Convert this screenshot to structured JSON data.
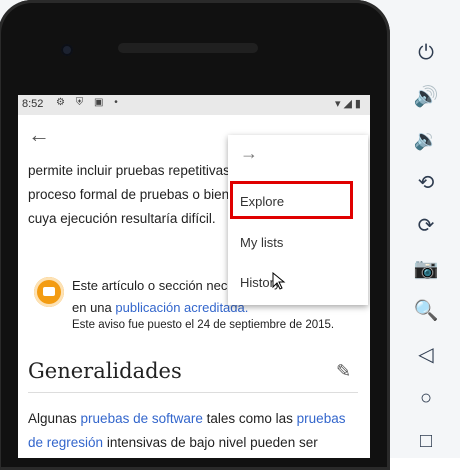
{
  "statusbar": {
    "time": "8:52"
  },
  "toolbar": {
    "back_label": "←"
  },
  "article": {
    "p1": "permite incluir pruebas repetitivas dentro de un proceso formal de pruebas o bien adicionar pruebas cuya ejecución resultaría difícil.",
    "notice_pre": "Este artículo o sección necesita que aparezcan en una ",
    "notice_link": "publicación acreditada.",
    "notice_small": "Este aviso fue puesto el 24 de septiembre de 2015.",
    "heading": "Generalidades",
    "p2_pre": "Algunas ",
    "p2_link1": "pruebas de software",
    "p2_mid": " tales como las ",
    "p2_link2": "pruebas de regresión",
    "p2_post": " intensivas de bajo nivel pueden ser"
  },
  "menu": {
    "forward_label": "→",
    "items": [
      "Explore",
      "My lists",
      "History"
    ]
  },
  "side_tools": [
    "power-icon",
    "volume-up-icon",
    "volume-down-icon",
    "rotate-left-icon",
    "rotate-right-icon",
    "camera-icon",
    "zoom-icon",
    "back-icon",
    "home-icon",
    "overview-icon"
  ]
}
